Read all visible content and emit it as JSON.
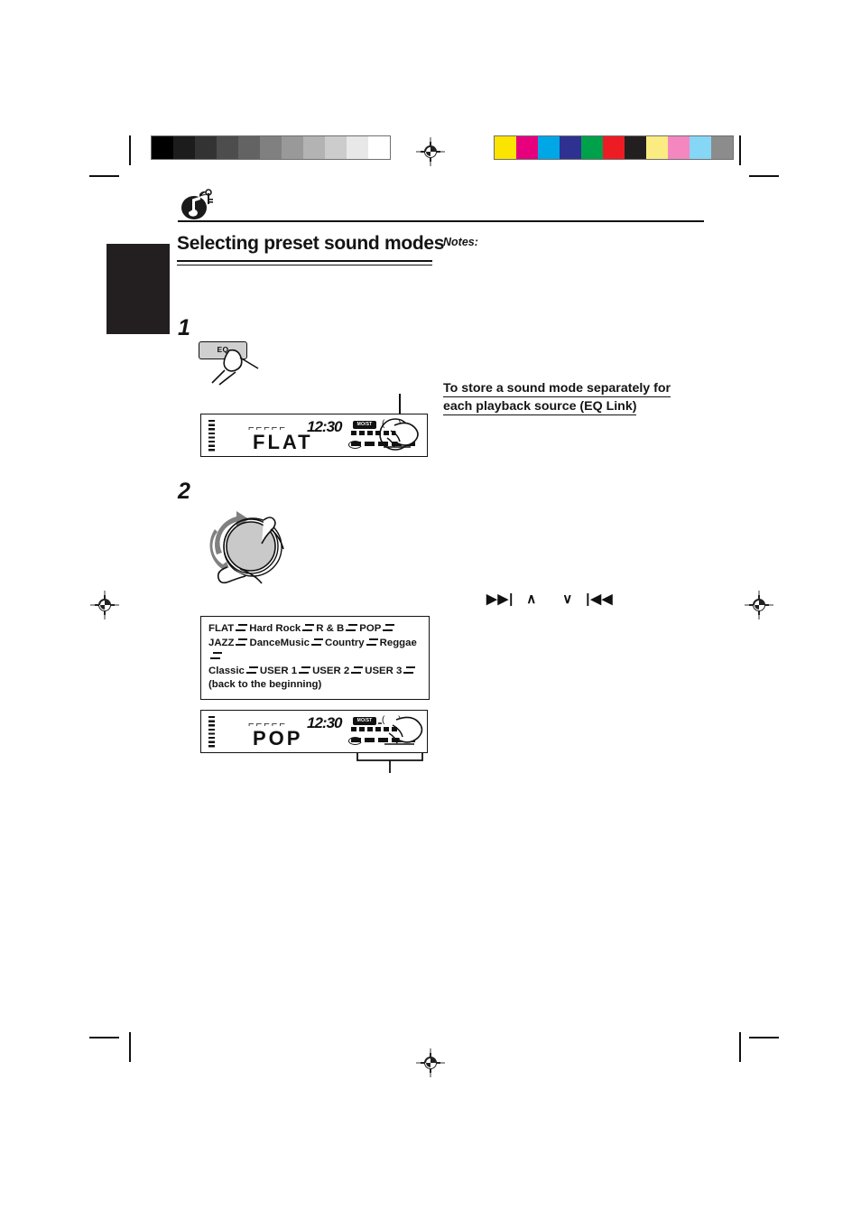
{
  "page": {
    "title": "Selecting preset sound modes",
    "notes_label": "Notes:",
    "icon": "music-note-icon"
  },
  "steps": [
    {
      "number": "1",
      "button_label": "EQ"
    },
    {
      "number": "2"
    }
  ],
  "displays": [
    {
      "name": "lcd-display-flat",
      "mode_text": "FLAT",
      "clock": "12:30",
      "dashes": "⌐⌐⌐⌐⌐",
      "badge": "MO/ST",
      "brackets": "( )"
    },
    {
      "name": "lcd-display-pop",
      "mode_text": "POP",
      "clock": "12:30",
      "dashes": "⌐⌐⌐⌐⌐",
      "badge": "MO/ST",
      "brackets": "( )"
    }
  ],
  "mode_list": {
    "line1": [
      "FLAT",
      "Hard Rock",
      "R & B",
      "POP"
    ],
    "line2": [
      "JAZZ",
      "DanceMusic",
      "Country",
      "Reggae"
    ],
    "line3": [
      "Classic",
      "USER 1",
      "USER 2",
      "USER 3"
    ],
    "footer": "(back to the beginning)"
  },
  "right_column": {
    "eq_link_heading_line1": "To store a sound mode separately for",
    "eq_link_heading_line2": "each playback source (EQ Link)",
    "nav_glyphs": [
      "▶▶|",
      "∧",
      "∨",
      "|◀◀"
    ]
  },
  "calibration": {
    "grayscale": [
      "#000000",
      "#1c1c1c",
      "#333333",
      "#4d4d4d",
      "#636363",
      "#808080",
      "#999999",
      "#b3b3b3",
      "#cccccc",
      "#e8e8e8",
      "#ffffff"
    ],
    "colors": [
      "#fbe400",
      "#e6007e",
      "#00a7e7",
      "#2e3192",
      "#00a14b",
      "#ed1c24",
      "#231f20",
      "#fbec81",
      "#f487c0",
      "#86d6f5",
      "#8c8c8c"
    ]
  }
}
